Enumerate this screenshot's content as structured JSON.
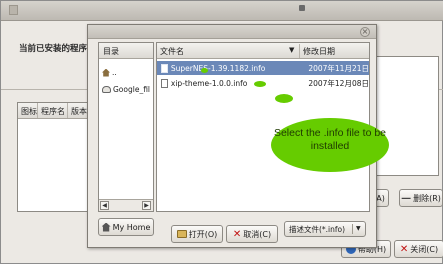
{
  "background_window": {
    "header": "当前已安装的程序",
    "columns": [
      "图标",
      "程序名",
      "版本"
    ],
    "add_button": "加(A)",
    "delete_button": "删除(R)",
    "help_button": "帮助(H)",
    "close_button": "关闭(C)"
  },
  "dialog": {
    "places_header": "目录",
    "places": [
      {
        "label": ".."
      },
      {
        "label": "Google_fil"
      }
    ],
    "myhome_label": "My Home",
    "columns": {
      "name": "文件名",
      "date": "修改日期"
    },
    "files": [
      {
        "name": "SuperNES-1.39.1182.info",
        "date": "2007年11月21日",
        "selected": true
      },
      {
        "name": "xip-theme-1.0.0.info",
        "date": "2007年12月08日",
        "selected": false
      }
    ],
    "filter": "描述文件(*.info)",
    "open_button": "打开(O)",
    "cancel_button": "取消(C)"
  },
  "callout": {
    "text": "Select the .info file to be installed"
  },
  "colors": {
    "selection": "#6b88b8",
    "callout": "#66cc00",
    "window_bg": "#ece9e4"
  }
}
